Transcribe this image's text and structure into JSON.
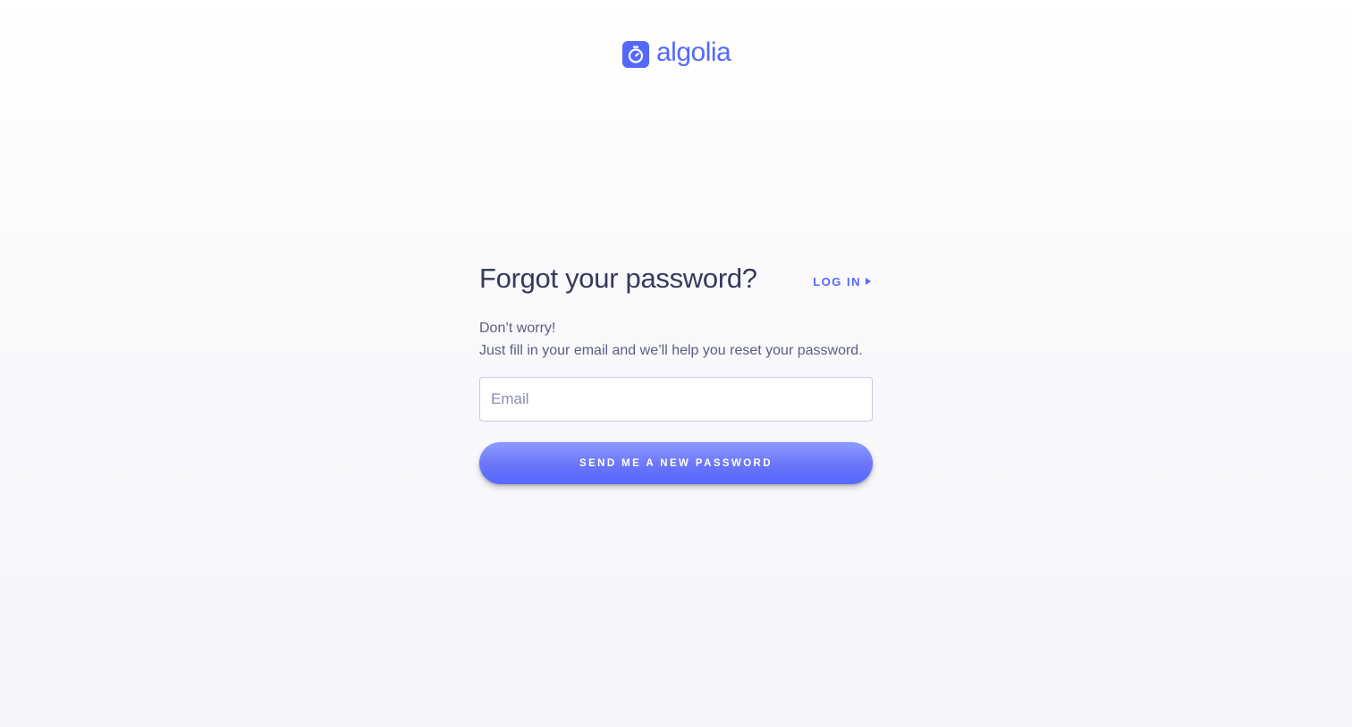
{
  "brand": {
    "logo_icon": "stopwatch-icon",
    "name": "algolia",
    "color": "#5468ff"
  },
  "header": {
    "title": "Forgot your password?",
    "login_link": "LOG IN",
    "login_icon": "play-triangle-icon"
  },
  "description": {
    "line1": "Don’t worry!",
    "line2": "Just fill in your email and we’ll help you reset your password."
  },
  "form": {
    "email_placeholder": "Email",
    "email_value": "",
    "submit_label": "SEND ME A NEW PASSWORD"
  }
}
